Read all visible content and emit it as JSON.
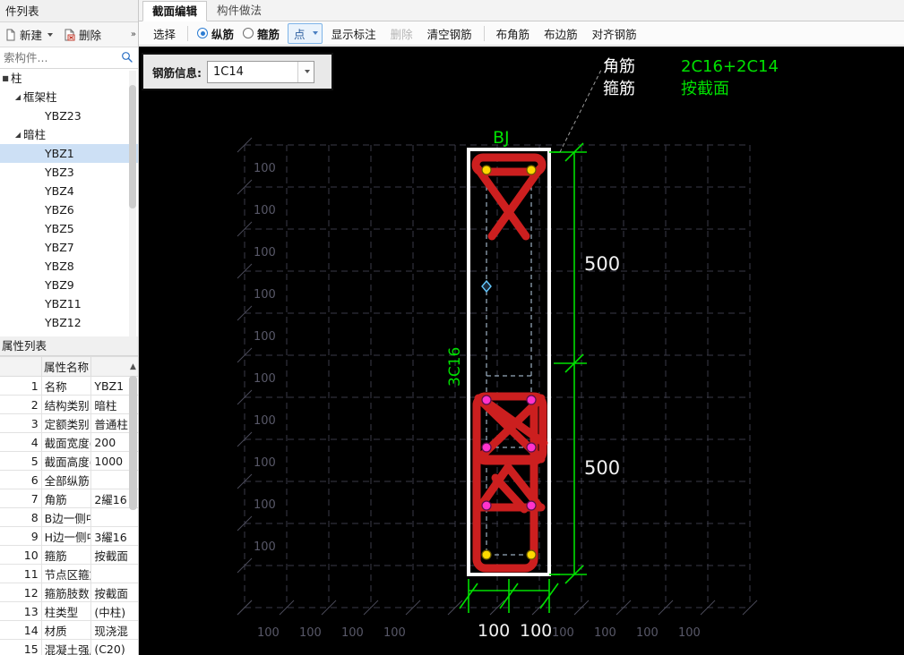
{
  "left_panel": {
    "title": "件列表",
    "toolbar": {
      "new_label": "新建",
      "delete_label": "删除",
      "overflow_label": "»"
    },
    "search": {
      "placeholder": "索构件...",
      "value": "",
      "icon": "search-icon"
    },
    "tree": [
      {
        "label": "柱",
        "level": 0,
        "twisty": "■",
        "selected": false
      },
      {
        "label": "框架柱",
        "level": 1,
        "twisty": "◢",
        "selected": false
      },
      {
        "label": "YBZ23",
        "level": 2,
        "twisty": "",
        "selected": false
      },
      {
        "label": "暗柱",
        "level": 1,
        "twisty": "◢",
        "selected": false
      },
      {
        "label": "YBZ1",
        "level": 2,
        "twisty": "",
        "selected": true
      },
      {
        "label": "YBZ3",
        "level": 2,
        "twisty": "",
        "selected": false
      },
      {
        "label": "YBZ4",
        "level": 2,
        "twisty": "",
        "selected": false
      },
      {
        "label": "YBZ6",
        "level": 2,
        "twisty": "",
        "selected": false
      },
      {
        "label": "YBZ5",
        "level": 2,
        "twisty": "",
        "selected": false
      },
      {
        "label": "YBZ7",
        "level": 2,
        "twisty": "",
        "selected": false
      },
      {
        "label": "YBZ8",
        "level": 2,
        "twisty": "",
        "selected": false
      },
      {
        "label": "YBZ9",
        "level": 2,
        "twisty": "",
        "selected": false
      },
      {
        "label": "YBZ11",
        "level": 2,
        "twisty": "",
        "selected": false
      },
      {
        "label": "YBZ12",
        "level": 2,
        "twisty": "",
        "selected": false
      }
    ]
  },
  "properties": {
    "panel_title": "属性列表",
    "header_name": "属性名称",
    "header_value": "",
    "rows": [
      {
        "idx": "1",
        "name": "名称",
        "value": "YBZ1",
        "blue": true
      },
      {
        "idx": "2",
        "name": "结构类别",
        "value": "暗柱",
        "blue": true
      },
      {
        "idx": "3",
        "name": "定额类别",
        "value": "普通柱",
        "blue": true
      },
      {
        "idx": "4",
        "name": "截面宽度(B边)(...",
        "value": "200",
        "blue": true
      },
      {
        "idx": "5",
        "name": "截面高度(H边)(...",
        "value": "1000",
        "blue": true
      },
      {
        "idx": "6",
        "name": "全部纵筋",
        "value": "",
        "blue": true
      },
      {
        "idx": "7",
        "name": "角筋",
        "value": "2䌦16",
        "blue": true
      },
      {
        "idx": "8",
        "name": "B边一侧中部筋",
        "value": "",
        "blue": false
      },
      {
        "idx": "9",
        "name": "H边一侧中部筋",
        "value": "3䌦16",
        "blue": false
      },
      {
        "idx": "10",
        "name": "箍筋",
        "value": "按截面",
        "blue": true
      },
      {
        "idx": "11",
        "name": "节点区箍筋",
        "value": "",
        "blue": true
      },
      {
        "idx": "12",
        "name": "箍筋肢数",
        "value": "按截面",
        "blue": true
      },
      {
        "idx": "13",
        "name": "柱类型",
        "value": "(中柱)",
        "blue": false
      },
      {
        "idx": "14",
        "name": "材质",
        "value": "现浇混",
        "blue": true
      },
      {
        "idx": "15",
        "name": "混凝土强度等级",
        "value": "(C20)",
        "blue": true
      }
    ]
  },
  "tabs": [
    {
      "label": "截面编辑",
      "active": true
    },
    {
      "label": "构件做法",
      "active": false
    }
  ],
  "section_toolbar": {
    "select_label": "选择",
    "radios": [
      {
        "label": "纵筋",
        "checked": true
      },
      {
        "label": "箍筋",
        "checked": false
      }
    ],
    "mode_button": {
      "label": "点",
      "caret": "chevron-down-icon"
    },
    "items": [
      {
        "label": "显示标注",
        "disabled": false
      },
      {
        "label": "删除",
        "disabled": true
      },
      {
        "label": "清空钢筋",
        "disabled": false
      },
      {
        "label": "布角筋",
        "disabled": false
      },
      {
        "label": "布边筋",
        "disabled": false
      },
      {
        "label": "对齐钢筋",
        "disabled": false
      }
    ]
  },
  "rebar_bar": {
    "label": "钢筋信息:",
    "value": "1C14",
    "dropdown_icon": "chevron-down-icon"
  },
  "canvas": {
    "background": "#000000",
    "grid_color": "#3a3a48",
    "dim_color": "#00e000",
    "rebar_color": "#cc1f1f",
    "outline_color": "#ffffff",
    "section_label": "BJ",
    "side_label": "3C16",
    "callout": [
      {
        "key": "角筋",
        "value": "2C16+2C14"
      },
      {
        "key": "箍筋",
        "value": "按截面"
      }
    ],
    "vertical_dims": [
      "500",
      "500"
    ],
    "bottom_dims_active": [
      "100",
      "100"
    ],
    "grid_labels_left": [
      "100",
      "100",
      "100",
      "100",
      "100",
      "100",
      "100",
      "100",
      "100",
      "100"
    ],
    "grid_labels_bottom": [
      "100",
      "100",
      "100",
      "100",
      "100",
      "100",
      "100",
      "100",
      "100",
      "100"
    ]
  }
}
